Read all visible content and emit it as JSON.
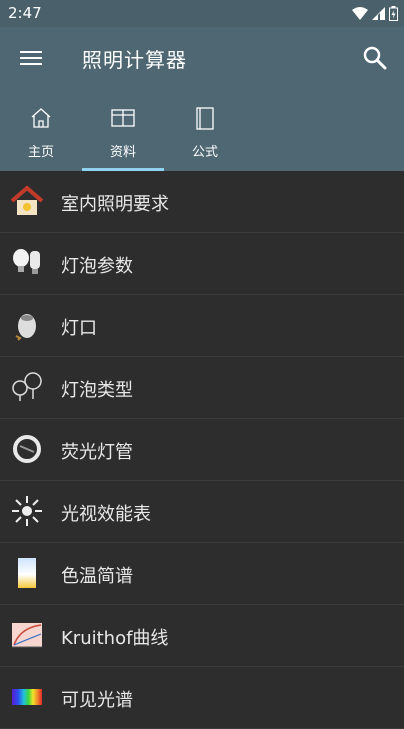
{
  "status_bar": {
    "time": "2:47"
  },
  "app_bar": {
    "title": "照明计算器"
  },
  "tabs": [
    {
      "label": "主页",
      "icon": "home-icon"
    },
    {
      "label": "资料",
      "icon": "book-open-icon",
      "selected": true
    },
    {
      "label": "公式",
      "icon": "book-icon"
    }
  ],
  "items": [
    {
      "label": "室内照明要求",
      "icon": "house-icon"
    },
    {
      "label": "灯泡参数",
      "icon": "bulbs-icon"
    },
    {
      "label": "灯口",
      "icon": "lamp-socket-icon"
    },
    {
      "label": "灯泡类型",
      "icon": "bulb-outline-icon"
    },
    {
      "label": "荧光灯管",
      "icon": "fluorescent-ring-icon"
    },
    {
      "label": "光视效能表",
      "icon": "sun-icon"
    },
    {
      "label": "色温简谱",
      "icon": "color-temperature-icon"
    },
    {
      "label": "Kruithof曲线",
      "icon": "kruithof-chart-icon"
    },
    {
      "label": "可见光谱",
      "icon": "spectrum-icon"
    }
  ],
  "colors": {
    "appbar": "#4e6773",
    "status_bar": "#4a606b",
    "background": "#2d2d2d",
    "tab_indicator": "#8fd3f0"
  }
}
